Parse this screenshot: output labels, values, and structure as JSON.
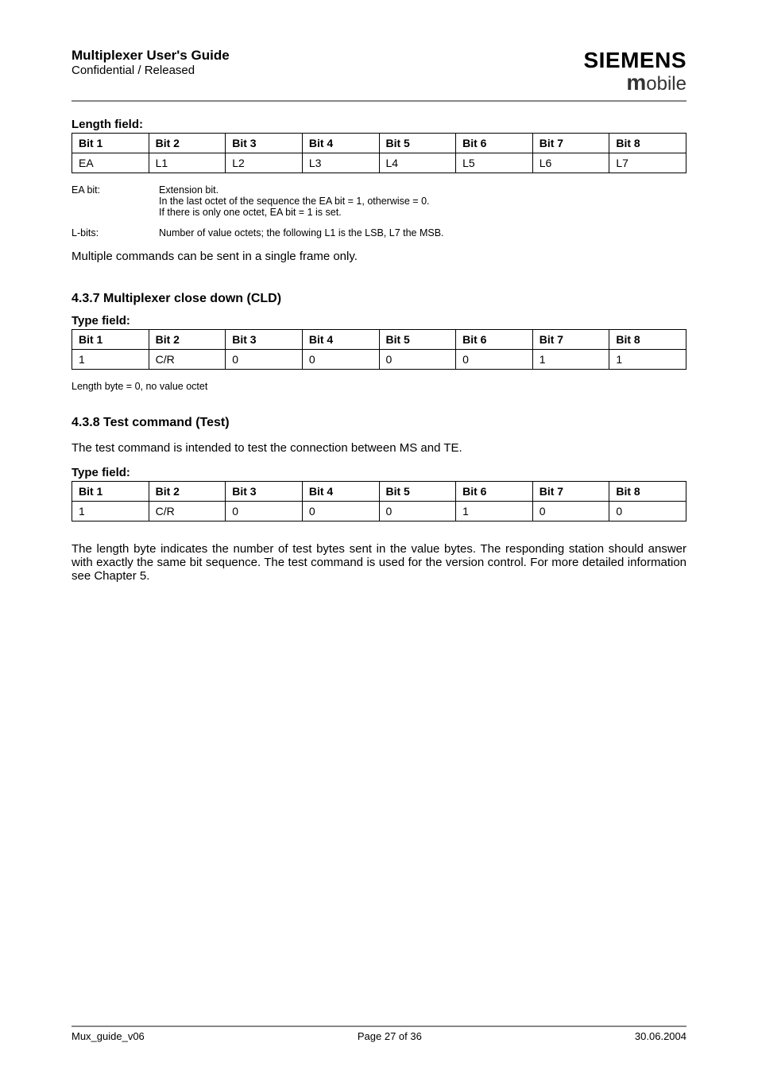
{
  "header": {
    "title1": "Multiplexer User's Guide",
    "title2": "Confidential / Released",
    "brand1": "SIEMENS",
    "brand2_m": "m",
    "brand2_rest": "obile"
  },
  "lengthField": {
    "label": "Length field:",
    "headers": [
      "Bit 1",
      "Bit 2",
      "Bit 3",
      "Bit 4",
      "Bit 5",
      "Bit 6",
      "Bit 7",
      "Bit 8"
    ],
    "row": [
      "EA",
      "L1",
      "L2",
      "L3",
      "L4",
      "L5",
      "L6",
      "L7"
    ]
  },
  "defs": {
    "ea": {
      "term": "EA bit:",
      "l1": "Extension bit.",
      "l2": "In the last octet of the sequence the EA bit = 1, otherwise   = 0.",
      "l3": "If there is only one octet, EA bit = 1 is set."
    },
    "lbits": {
      "term": "L-bits:",
      "l1": "Number of value octets; the following L1 is the LSB, L7 the MSB."
    }
  },
  "para1": "Multiple commands can be sent in a single frame only.",
  "sec437": {
    "heading": "4.3.7   Multiplexer close down (CLD)",
    "typeLabel": "Type field:",
    "headers": [
      "Bit 1",
      "Bit 2",
      "Bit 3",
      "Bit 4",
      "Bit 5",
      "Bit 6",
      "Bit 7",
      "Bit 8"
    ],
    "row": [
      "1",
      "C/R",
      "0",
      "0",
      "0",
      "0",
      "1",
      "1"
    ],
    "note": "Length byte = 0, no value octet"
  },
  "sec438": {
    "heading": "4.3.8   Test command (Test)",
    "para": "The test command is intended to test the connection between MS and TE.",
    "typeLabel": "Type field:",
    "headers": [
      "Bit 1",
      "Bit 2",
      "Bit 3",
      "Bit 4",
      "Bit 5",
      "Bit 6",
      "Bit 7",
      "Bit 8"
    ],
    "row": [
      "1",
      "C/R",
      "0",
      "0",
      "0",
      "1",
      "0",
      "0"
    ],
    "paraAfter": "The length byte indicates the number of test bytes sent in the value bytes. The responding station should answer with exactly the same bit sequence. The test command is used for the version control. For more detailed information see Chapter 5."
  },
  "footer": {
    "left": "Mux_guide_v06",
    "center": "Page 27 of 36",
    "right": "30.06.2004"
  }
}
